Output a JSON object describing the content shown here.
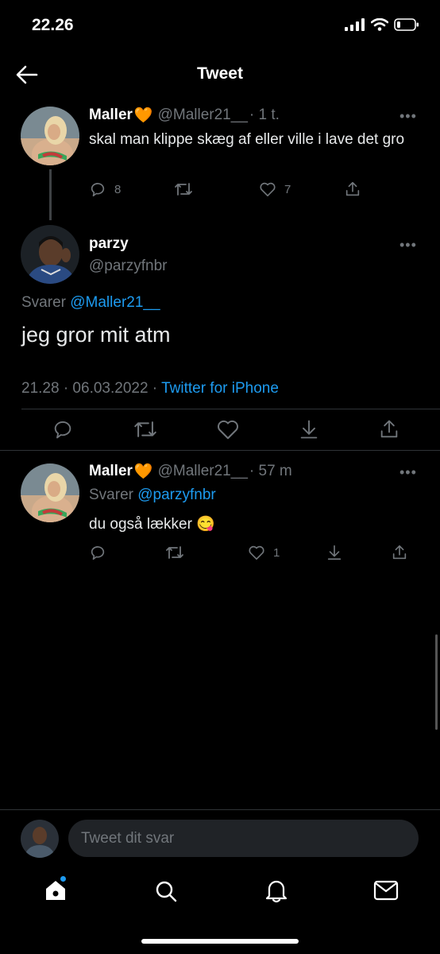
{
  "status_bar": {
    "time": "22.26"
  },
  "header": {
    "title": "Tweet"
  },
  "tweets": [
    {
      "name": "Maller",
      "emoji": "🧡",
      "handle": "@Maller21__",
      "time": "· 1 t.",
      "text": "skal man klippe skæg af eller ville i lave det gro",
      "replies": "8",
      "likes": "7"
    },
    {
      "name": "parzy",
      "handle": "@parzyfnbr",
      "reply_prefix": "Svarer",
      "reply_to": "@Maller21__",
      "text": "jeg gror mit atm",
      "datetime": "21.28 · 06.03.2022 ·",
      "source": "Twitter for iPhone"
    },
    {
      "name": "Maller",
      "emoji": "🧡",
      "handle": "@Maller21__",
      "time": "· 57 m",
      "reply_prefix": "Svarer",
      "reply_to": "@parzyfnbr",
      "text": "du også lækker",
      "text_emoji": "😋",
      "likes": "1"
    }
  ],
  "reply_box": {
    "placeholder": "Tweet dit svar"
  },
  "colors": {
    "accent": "#1d9bf0",
    "secondary": "#71767b",
    "background": "#000000"
  }
}
